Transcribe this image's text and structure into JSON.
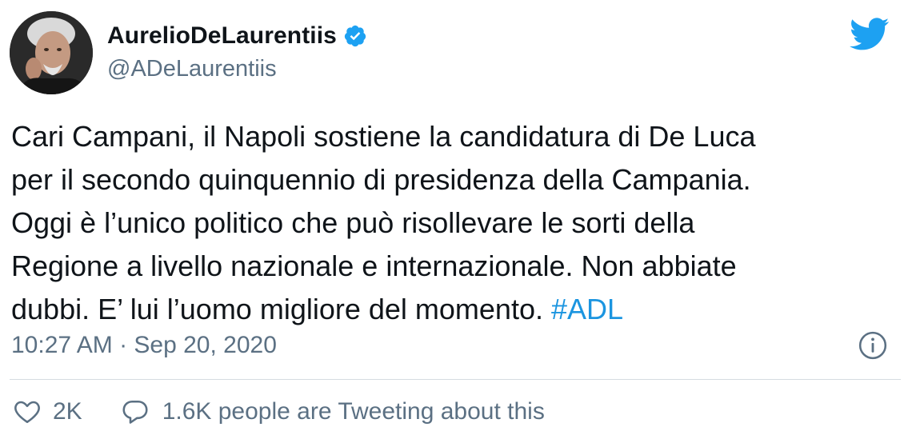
{
  "author": {
    "display_name": "AurelioDeLaurentiis",
    "handle": "@ADeLaurentiis",
    "verified": true
  },
  "tweet": {
    "lines": [
      "Cari Campani, il Napoli sostiene la candidatura di De Luca",
      "per il secondo quinquennio di presidenza della Campania.",
      "Oggi è l’unico politico che può risollevare le sorti della",
      "Regione a livello nazionale e internazionale. Non abbiate",
      "dubbi. E’ lui l’uomo migliore del momento. "
    ],
    "hashtag": "#ADL",
    "timestamp": "10:27 AM · Sep 20, 2020"
  },
  "engagement": {
    "likes": "2K",
    "conversation": "1.6K people are Tweeting about this"
  },
  "icons": {
    "brand": "twitter-bird-icon",
    "verified": "verified-badge-icon",
    "info": "info-icon",
    "like": "heart-icon",
    "reply": "speech-bubble-icon"
  },
  "colors": {
    "brand_blue": "#1da1f2",
    "hashtag": "#1b95e0",
    "secondary_text": "#5b7083",
    "primary_text": "#0f1419"
  }
}
